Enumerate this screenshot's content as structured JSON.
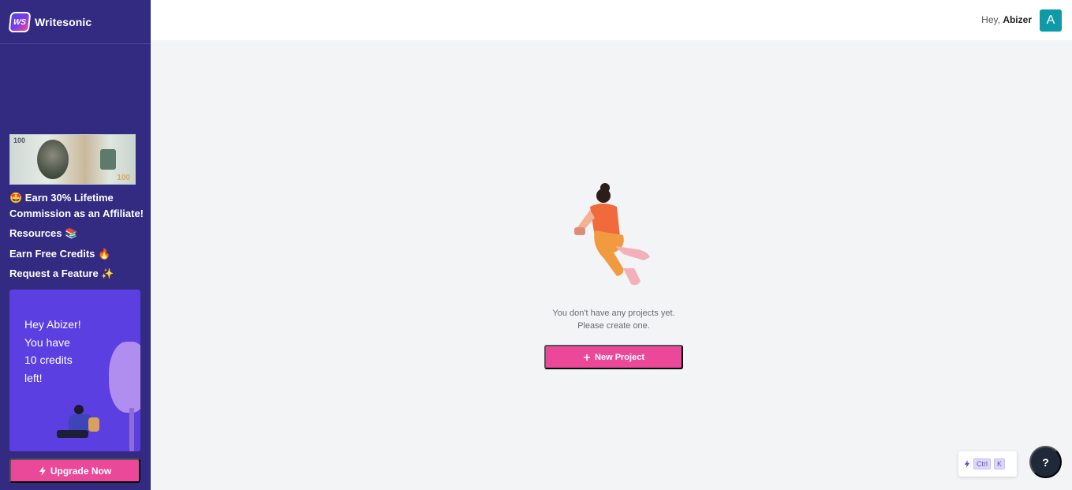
{
  "brand": {
    "logo_text": "WS",
    "name": "Writesonic"
  },
  "sidebar": {
    "banner": {
      "serial_left": "100",
      "serial_right": "100"
    },
    "affiliate_label": "🤩 Earn 30% Lifetime Commission as an Affiliate!",
    "resources_label": "Resources 📚",
    "credits_label": "Earn Free Credits 🔥",
    "feature_label": "Request a Feature ✨",
    "credit_card": {
      "line1": "Hey Abizer!",
      "line2": "You have",
      "line3": "10 credits",
      "line4": "left!"
    },
    "upgrade_label": "Upgrade Now"
  },
  "header": {
    "greeting_prefix": "Hey,",
    "user_name": "Abizer",
    "avatar_letter": "A"
  },
  "main": {
    "empty_line1": "You don't have any projects yet.",
    "empty_line2": "Please create one.",
    "new_project_label": "New Project"
  },
  "shortcut": {
    "key1": "Ctrl",
    "key2": "K"
  },
  "help_label": "?",
  "colors": {
    "sidebar": "#332a82",
    "accent": "#ec4899",
    "avatar": "#0e9aa7",
    "card": "#5b3fe0"
  }
}
